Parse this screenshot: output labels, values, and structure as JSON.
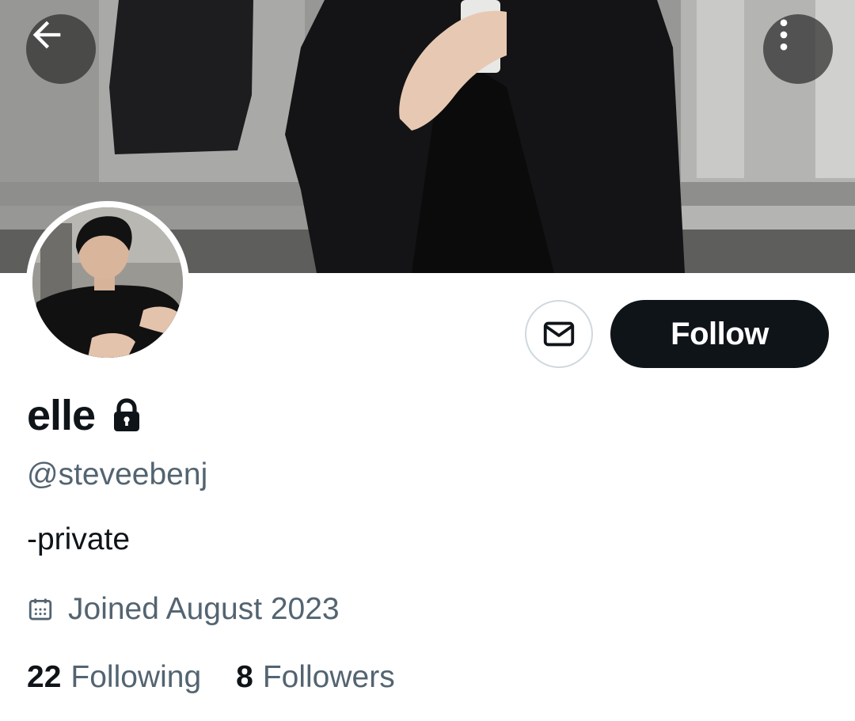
{
  "header": {
    "back_icon": "arrow-left-icon",
    "more_icon": "more-vertical-icon"
  },
  "profile": {
    "display_name": "elle",
    "protected_icon": "lock-icon",
    "handle": "@steveebenj",
    "bio": "-private",
    "joined_icon": "calendar-icon",
    "joined": "Joined August 2023"
  },
  "actions": {
    "message_icon": "envelope-icon",
    "follow_label": "Follow"
  },
  "stats": {
    "following_count": "22",
    "following_label": "Following",
    "followers_count": "8",
    "followers_label": "Followers"
  },
  "colors": {
    "primary_text": "#0f1419",
    "secondary_text": "#536471",
    "button_dark": "#0f1419",
    "border": "#cfd9de"
  }
}
